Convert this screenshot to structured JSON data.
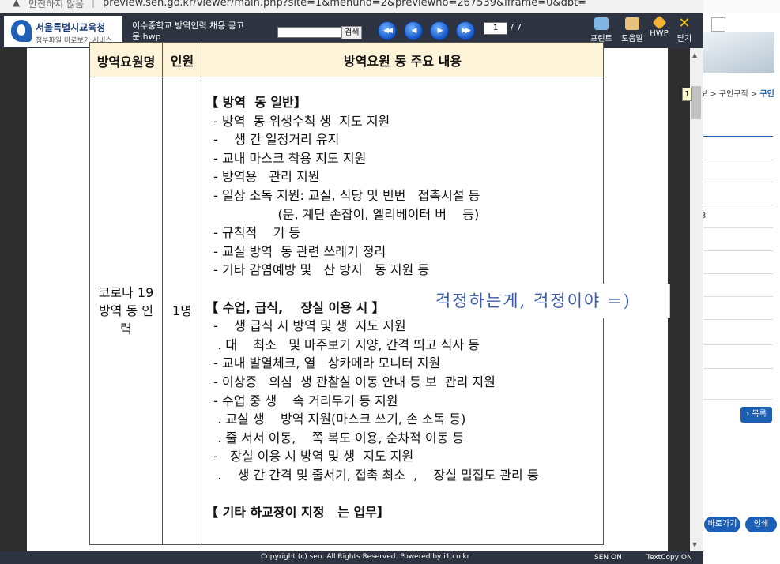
{
  "browser": {
    "security_text": "안전하지 않음",
    "separator": "|",
    "url": "preview.sen.go.kr/viewer/main.php?site=1&menuno=2&previewno=267539&iframe=0&dbt="
  },
  "viewer": {
    "logo_title": "서울특별시교육청",
    "logo_subtitle": "첨부파일 바로보기 서비스",
    "file_name": "이수중학교 방역인력 채용 공고문.hwp",
    "search_value": "",
    "search_button": "검색",
    "page_current": "1",
    "page_total": "/ 7",
    "tools": {
      "print": "프린트",
      "help": "도움말",
      "hwp": "HWP",
      "close": "닫기"
    },
    "footer_copyright": "Copyright (c) sen. All Rights Reserved. Powered by i1.co.kr",
    "footer_badge1": "SEN ON",
    "footer_badge2": "TextCopy ON",
    "colors": {
      "header_bg": "#2d3340",
      "nav_blue": "#1456c7",
      "table_header_bg": "#fef4d9",
      "handwriting": "#3b5ba6"
    }
  },
  "document": {
    "table": {
      "headers": [
        "방역요원명",
        "인원",
        "방역요원   동 주요 내용"
      ],
      "role": "코로나 19 방역  동 인력",
      "count": "1명",
      "lines": [
        {
          "t": "【 방역  동 일반】",
          "b": true
        },
        {
          "t": "  - 방역  동 위생수칙 생  지도 지원"
        },
        {
          "t": "  -    생 간 일정거리 유지"
        },
        {
          "t": "  - 교내 마스크 착용 지도 지원"
        },
        {
          "t": "  - 방역용   관리 지원"
        },
        {
          "t": "  - 일상 소독 지원: 교실, 식당 및 빈번   접촉시설 등"
        },
        {
          "t": "                  (문, 계단 손잡이, 엘리베이터 버    등)"
        },
        {
          "t": "  - 규칙적    기 등"
        },
        {
          "t": "  - 교실 방역  동 관련 쓰레기 정리"
        },
        {
          "t": "  - 기타 감염예방 및   산 방지   동 지원 등"
        },
        {
          "t": ""
        },
        {
          "t": "【 수업, 급식,    장실 이용 시 】",
          "b": true
        },
        {
          "t": "  -    생 급식 시 방역 및 생  지도 지원"
        },
        {
          "t": "   . 대    최소   및 마주보기 지양, 간격 띄고 식사 등"
        },
        {
          "t": "  - 교내 발열체크, 열   상카메라 모니터 지원"
        },
        {
          "t": "  - 이상증   의심  생 관찰실 이동 안내 등 보  관리 지원"
        },
        {
          "t": "  - 수업 중 생    속 거리두기 등 지원"
        },
        {
          "t": "   . 교실 생    방역 지원(마스크 쓰기, 손 소독 등)"
        },
        {
          "t": "   . 줄 서서 이동,    쪽 복도 이용, 순차적 이동 등"
        },
        {
          "t": "  -   장실 이용 시 방역 및 생  지도 지원"
        },
        {
          "t": "   .    생 간 간격 및 줄서기, 접촉 최소  ,    장실 밀집도 관리 등"
        },
        {
          "t": ""
        },
        {
          "t": "【 기타 하교장이 지정   는 업무】",
          "b": true
        }
      ]
    },
    "handwriting": "걱정하는게, 걱정이야 =)"
  },
  "background_page": {
    "breadcrumb_partial": "보 > 구인구직 >",
    "breadcrumb_current": "구인",
    "partial_number": "3",
    "list_button": "› 목록",
    "go_button": "바로가기",
    "print_button": "인쇄",
    "page_bubble": "1"
  }
}
